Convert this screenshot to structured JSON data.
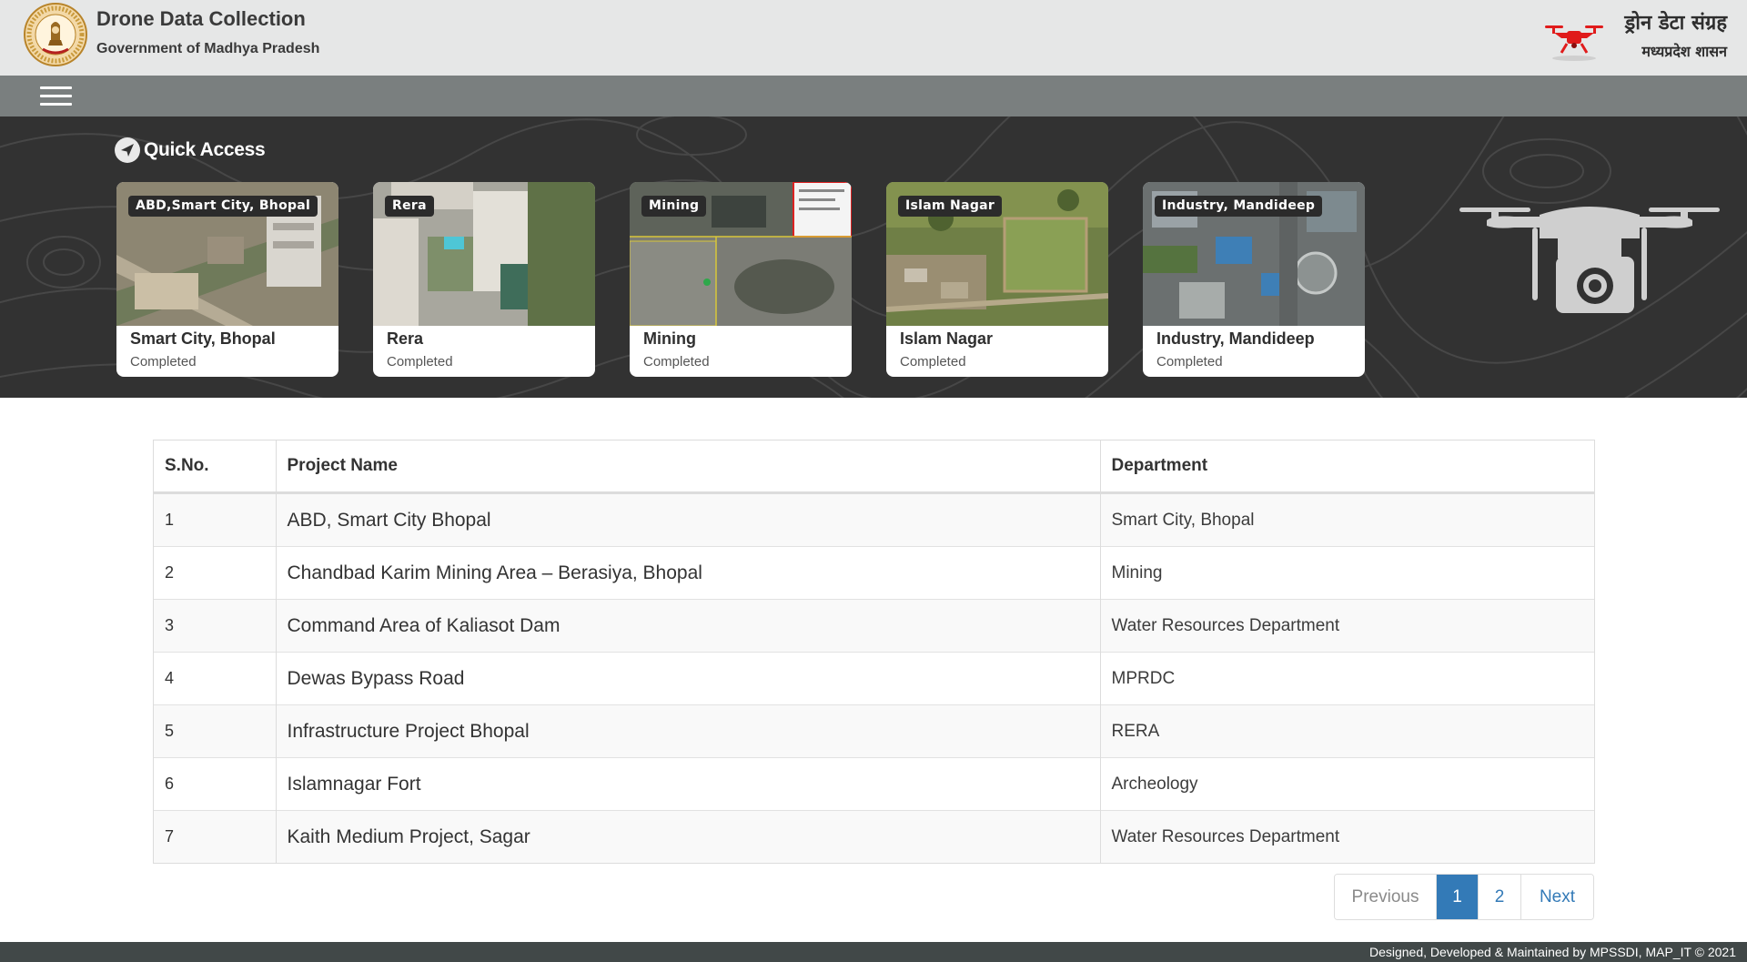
{
  "header": {
    "title": "Drone Data Collection",
    "subtitle": "Government of Madhya Pradesh",
    "hindi_title": "ड्रोन डेटा संग्रह",
    "hindi_subtitle": "मध्यप्रदेश शासन"
  },
  "quick_access": {
    "title": "Quick Access",
    "cards": [
      {
        "badge": "ABD,Smart City, Bhopal",
        "title": "Smart City, Bhopal",
        "status": "Completed"
      },
      {
        "badge": "Rera",
        "title": "Rera",
        "status": "Completed"
      },
      {
        "badge": "Mining",
        "title": "Mining",
        "status": "Completed"
      },
      {
        "badge": "Islam Nagar",
        "title": "Islam Nagar",
        "status": "Completed"
      },
      {
        "badge": "Industry, Mandideep",
        "title": "Industry, Mandideep",
        "status": "Completed"
      }
    ]
  },
  "table": {
    "columns": [
      "S.No.",
      "Project Name",
      "Department"
    ],
    "rows": [
      {
        "sno": "1",
        "project": "ABD, Smart City Bhopal",
        "department": "Smart City, Bhopal"
      },
      {
        "sno": "2",
        "project": "Chandbad Karim Mining Area – Berasiya, Bhopal",
        "department": "Mining"
      },
      {
        "sno": "3",
        "project": "Command Area of Kaliasot Dam",
        "department": "Water Resources Department"
      },
      {
        "sno": "4",
        "project": "Dewas Bypass Road",
        "department": "MPRDC"
      },
      {
        "sno": "5",
        "project": "Infrastructure Project Bhopal",
        "department": "RERA"
      },
      {
        "sno": "6",
        "project": "Islamnagar Fort",
        "department": "Archeology"
      },
      {
        "sno": "7",
        "project": "Kaith Medium Project, Sagar",
        "department": "Water Resources Department"
      }
    ]
  },
  "pagination": {
    "previous": "Previous",
    "pages": [
      "1",
      "2"
    ],
    "current": "1",
    "next": "Next"
  },
  "footer": {
    "text": "Designed, Developed & Maintained by MPSSDI, MAP_IT © 2021"
  },
  "colors": {
    "header_bg": "#e6e7e7",
    "nav_bg": "#7a7f7f",
    "hero_bg": "#323232",
    "accent": "#337ab7",
    "drone_logo": "#e01b1b",
    "footer_bg": "#414848"
  },
  "icons": [
    "mp-government-emblem",
    "drone-logo-icon",
    "hamburger-menu-icon",
    "send-arrow-icon",
    "drone-camera-icon"
  ]
}
